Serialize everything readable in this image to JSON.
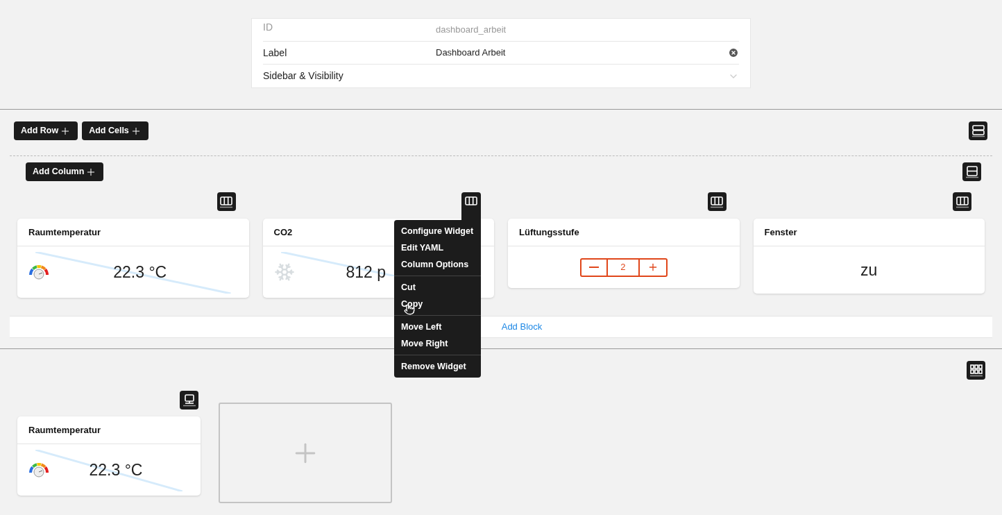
{
  "form": {
    "fields": [
      {
        "label": "ID",
        "value": "dashboard_arbeit",
        "kind": "readonly"
      },
      {
        "label": "Label",
        "value": "Dashboard Arbeit",
        "kind": "clearable"
      },
      {
        "label": "Sidebar & Visibility",
        "kind": "expander"
      }
    ]
  },
  "toolbar": {
    "buttons": [
      "Add Row",
      "Add Cells"
    ]
  },
  "block": {
    "add_column": "Add Column",
    "columns": [
      {
        "menu_open": false,
        "widget": {
          "title": "Raumtemperatur",
          "kind": "gauge",
          "value": "22.3 °C"
        }
      },
      {
        "menu_open": true,
        "widget": {
          "title": "CO2",
          "kind": "snow",
          "value": "812 p"
        }
      },
      {
        "menu_open": false,
        "widget": {
          "title": "Lüftungsstufe",
          "kind": "stepper",
          "value": "2"
        }
      },
      {
        "menu_open": false,
        "widget": {
          "title": "Fenster",
          "kind": "text",
          "value": "zu"
        }
      }
    ],
    "add_block": "Add Block"
  },
  "menu": {
    "groups": [
      [
        "Configure Widget",
        "Edit YAML",
        "Column Options"
      ],
      [
        "Cut",
        "Copy"
      ],
      [
        "Move Left",
        "Move Right"
      ],
      [
        "Remove Widget"
      ]
    ]
  },
  "cells": {
    "widget": {
      "title": "Raumtemperatur",
      "kind": "gauge",
      "value": "22.3 °C"
    }
  }
}
